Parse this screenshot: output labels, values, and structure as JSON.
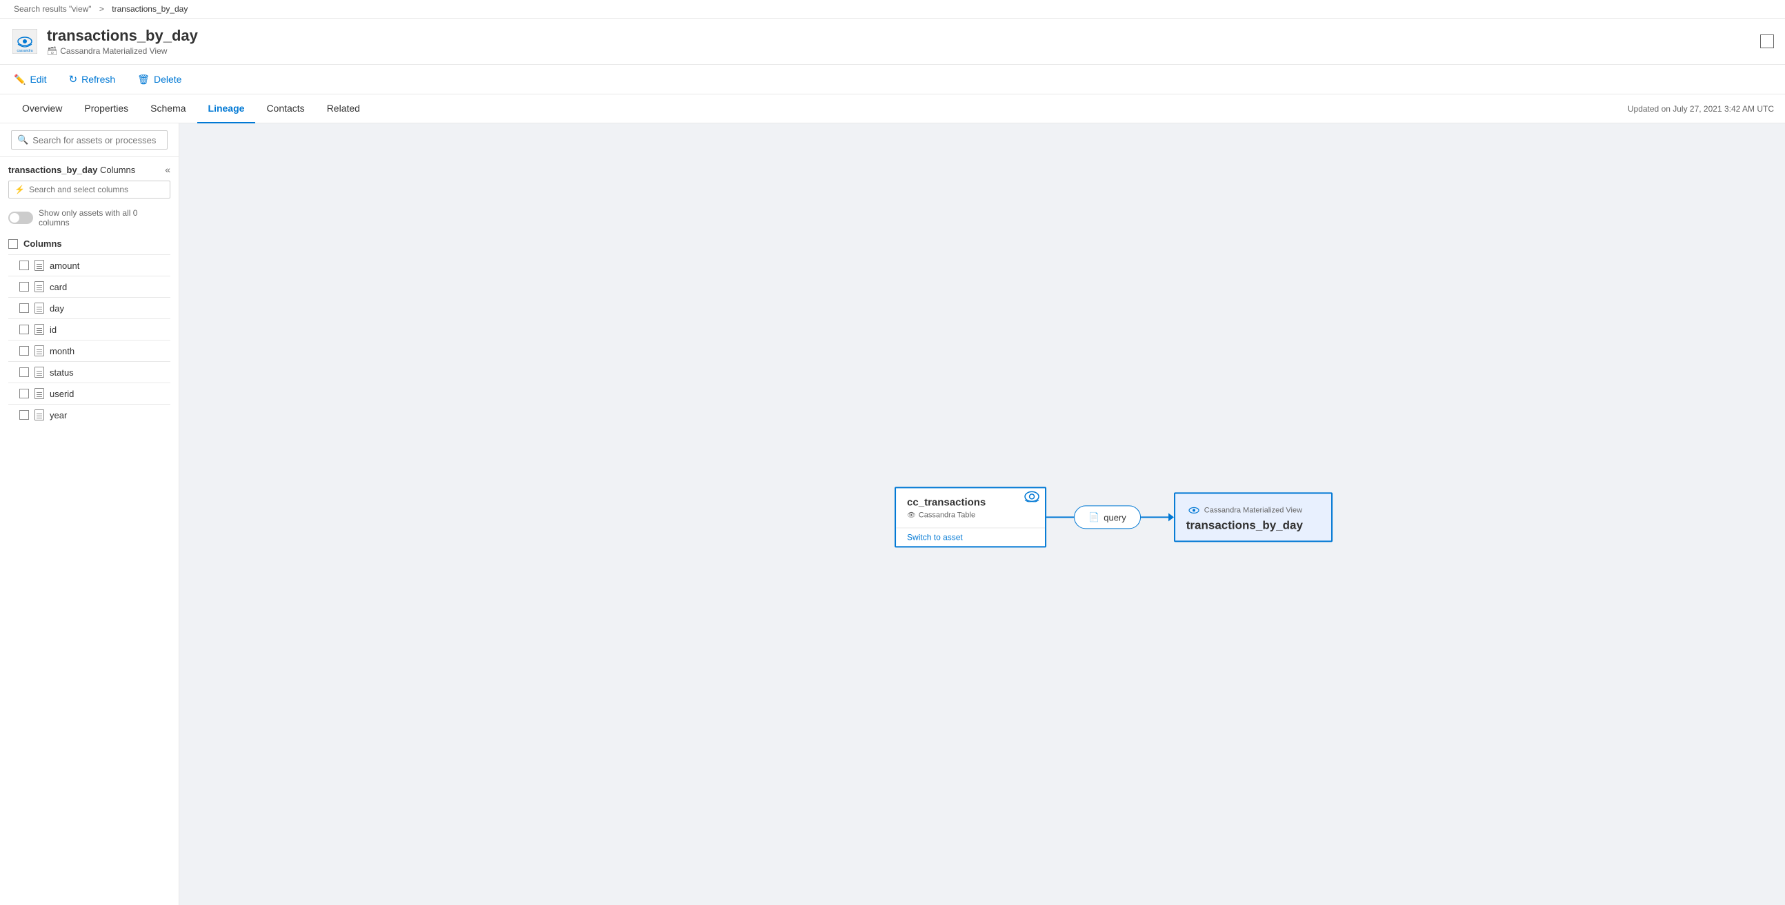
{
  "breadcrumb": {
    "search_part": "Search results \"view\"",
    "separator": ">",
    "current": "transactions_by_day"
  },
  "asset": {
    "title": "transactions_by_day",
    "subtitle": "Cassandra Materialized View",
    "subtitle_icon": "table-icon"
  },
  "toolbar": {
    "edit_label": "Edit",
    "refresh_label": "Refresh",
    "delete_label": "Delete"
  },
  "tabs": [
    {
      "id": "overview",
      "label": "Overview",
      "active": false
    },
    {
      "id": "properties",
      "label": "Properties",
      "active": false
    },
    {
      "id": "schema",
      "label": "Schema",
      "active": false
    },
    {
      "id": "lineage",
      "label": "Lineage",
      "active": true
    },
    {
      "id": "contacts",
      "label": "Contacts",
      "active": false
    },
    {
      "id": "related",
      "label": "Related",
      "active": false
    }
  ],
  "updated_text": "Updated on July 27, 2021 3:42 AM UTC",
  "search_assets": {
    "placeholder": "Search for assets or processes"
  },
  "panel": {
    "title_bold": "transactions_by_day",
    "title_suffix": " Columns"
  },
  "column_search": {
    "placeholder": "Search and select columns"
  },
  "toggle": {
    "label": "Show only assets with all 0 columns"
  },
  "columns": {
    "header": "Columns",
    "items": [
      {
        "name": "amount"
      },
      {
        "name": "card"
      },
      {
        "name": "day"
      },
      {
        "name": "id"
      },
      {
        "name": "month"
      },
      {
        "name": "status"
      },
      {
        "name": "userid"
      },
      {
        "name": "year"
      }
    ]
  },
  "lineage": {
    "source": {
      "title": "cc_transactions",
      "subtitle": "Cassandra Table",
      "link": "Switch to asset",
      "eye_icon": "eye-icon"
    },
    "process": {
      "label": "query",
      "icon": "document-icon"
    },
    "destination": {
      "subtitle_label": "Cassandra Materialized View",
      "title": "transactions_by_day"
    }
  }
}
